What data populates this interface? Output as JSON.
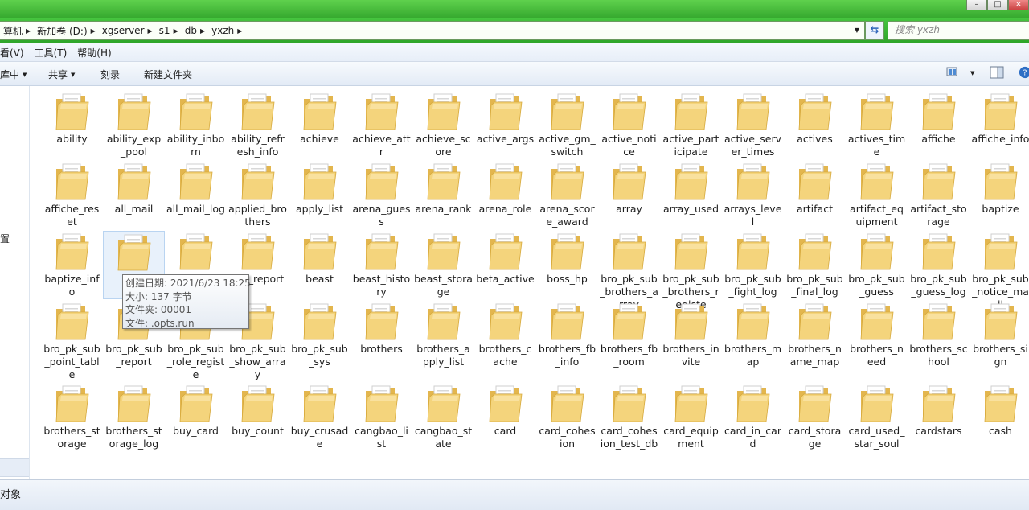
{
  "address": {
    "crumbs": [
      "算机",
      "新加卷 (D:)",
      "xgserver",
      "s1",
      "db",
      "yxzh"
    ],
    "search_placeholder": "搜索 yxzh"
  },
  "menu": [
    "看(V)",
    "工具(T)",
    "帮助(H)"
  ],
  "toolbar": {
    "organize": "库中",
    "share": "共享",
    "burn": "刻录",
    "new_folder": "新建文件夹"
  },
  "sidebar": {
    "fav_label": "置"
  },
  "folders": [
    "ability",
    "ability_exp_pool",
    "ability_inborn",
    "ability_refresh_info",
    "achieve",
    "achieve_attr",
    "achieve_score",
    "active_args",
    "active_gm_switch",
    "active_notice",
    "active_participate",
    "active_server_times",
    "actives",
    "actives_time",
    "affiche",
    "affiche_info",
    "affiche_reset",
    "all_mail",
    "all_mail_log",
    "applied_brothers",
    "apply_list",
    "arena_guess",
    "arena_rank",
    "arena_role",
    "arena_score_award",
    "array",
    "array_used",
    "arrays_level",
    "artifact",
    "artifact_equipment",
    "artifact_storage",
    "baptize",
    "baptize_info",
    "ba",
    "",
    "ttle_report",
    "beast",
    "beast_history",
    "beast_storage",
    "beta_active",
    "boss_hp",
    "bro_pk_sub_brothers_array",
    "bro_pk_sub_brothers_registe",
    "bro_pk_sub_fight_log",
    "bro_pk_sub_final_log",
    "bro_pk_sub_guess",
    "bro_pk_sub_guess_log",
    "bro_pk_sub_notice_mail",
    "bro_pk_sub_point_table",
    "bro_pk_sub_report",
    "bro_pk_sub_role_registe",
    "bro_pk_sub_show_array",
    "bro_pk_sub_sys",
    "brothers",
    "brothers_apply_list",
    "brothers_cache",
    "brothers_fb_info",
    "brothers_fb_room",
    "brothers_invite",
    "brothers_map",
    "brothers_name_map",
    "brothers_need",
    "brothers_school",
    "brothers_sign",
    "brothers_storage",
    "brothers_storage_log",
    "buy_card",
    "buy_count",
    "buy_crusade",
    "cangbao_list",
    "cangbao_state",
    "card",
    "card_cohesion",
    "card_cohesion_test_db",
    "card_equipment",
    "card_in_card",
    "card_storage",
    "card_used_star_soul",
    "cardstars",
    "cash"
  ],
  "tooltip": {
    "created": "创建日期: 2021/6/23 18:25",
    "size": "大小: 137 字节",
    "folders": "文件夹: 00001",
    "files": "文件: .opts.run"
  },
  "status": {
    "text": "对象"
  },
  "colors": {
    "titlebar": "#3cb035",
    "folder": "#f2d27a",
    "selection": "#e8f1fb"
  }
}
